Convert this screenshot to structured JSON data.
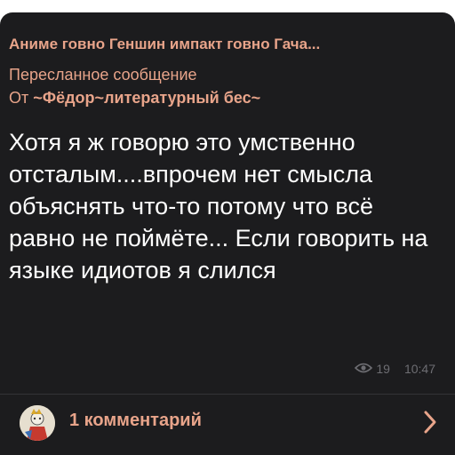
{
  "post": {
    "channel_title": "Аниме говно Геншин импакт говно Гача...",
    "forwarded_label": "Пересланное сообщение",
    "from_prefix": "От ",
    "from_author": "~Фёдор~литературный бес~",
    "text": "Хотя я ж говорю это умственно отсталым....впрочем нет смысла объяснять что-то потому что всё равно не поймёте... Если говорить на языке идиотов я слился",
    "views": "19",
    "time": "10:47"
  },
  "comments": {
    "label": "1 комментарий"
  },
  "icons": {
    "views": "eye-icon",
    "open": "chevron-right-icon",
    "avatar": "commenter-avatar"
  },
  "colors": {
    "background": "#1c1c1e",
    "accent": "#e8a48a",
    "text": "#ffffff",
    "meta": "#6d6d72"
  }
}
